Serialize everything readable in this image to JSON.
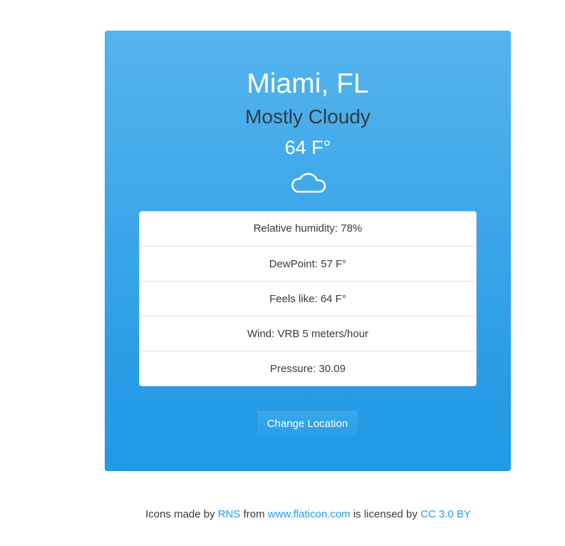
{
  "weather": {
    "city": "Miami, FL",
    "condition": "Mostly Cloudy",
    "temperature": "64 F°",
    "icon": "cloud-icon"
  },
  "details": [
    {
      "label": "Relative humidity: 78%"
    },
    {
      "label": "DewPoint: 57 F°"
    },
    {
      "label": "Feels like: 64 F°"
    },
    {
      "label": "Wind: VRB 5 meters/hour"
    },
    {
      "label": "Pressure: 30.09"
    }
  ],
  "actions": {
    "change_location": "Change Location"
  },
  "footer": {
    "text_1": "Icons made by ",
    "link_author": "RNS",
    "text_2": " from ",
    "link_site": "www.flaticon.com",
    "text_3": " is licensed by ",
    "link_license": "CC 3.0 BY"
  },
  "colors": {
    "card_top": "#55b4ec",
    "card_bottom": "#229ae6",
    "link": "#2a9de6"
  }
}
